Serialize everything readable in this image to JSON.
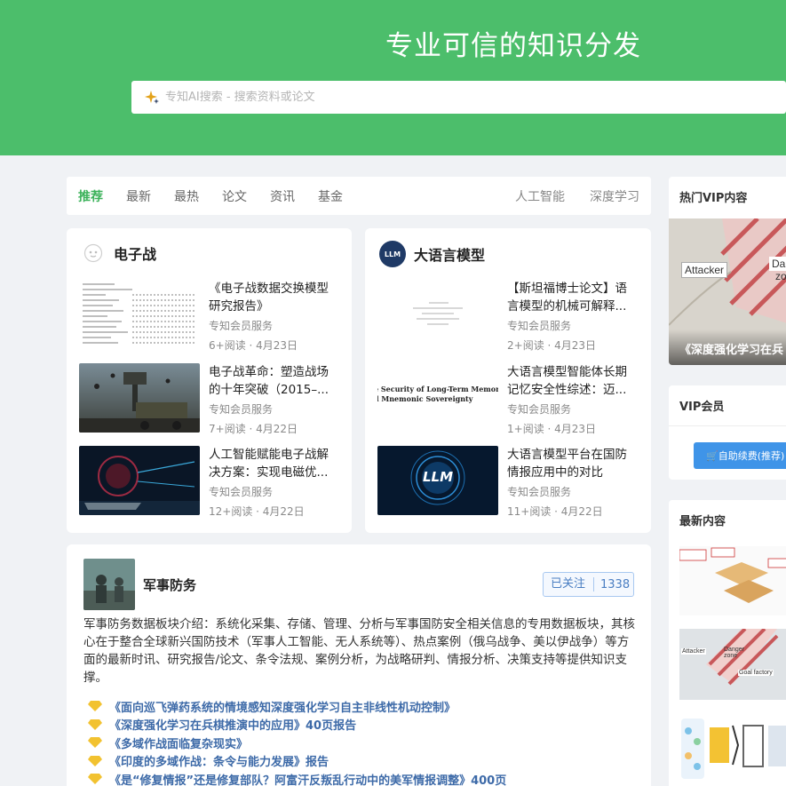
{
  "hero": {
    "title": "专业可信的知识分发",
    "search_placeholder": "专知AI搜索 - 搜索资料或论文",
    "bg_color": "#4cbe6b"
  },
  "tabs": {
    "left": [
      "推荐",
      "最新",
      "最热",
      "论文",
      "资讯",
      "基金"
    ],
    "right": [
      "人工智能",
      "深度学习"
    ],
    "active": "推荐"
  },
  "ew_card": {
    "title": "电子战",
    "items": [
      {
        "title": "《电子战数据交换模型研究报告》",
        "source": "专知会员服务",
        "meta": "6+阅读 · 4月23日"
      },
      {
        "title": "电子战革命：塑造战场的十年突破（2015–...",
        "source": "专知会员服务",
        "meta": "7+阅读 · 4月22日"
      },
      {
        "title": "人工智能赋能电子战解决方案：实现电磁优...",
        "source": "专知会员服务",
        "meta": "12+阅读 · 4月22日"
      }
    ]
  },
  "llm_card": {
    "title": "大语言模型",
    "avatar_text": "LLM",
    "items": [
      {
        "title": "【斯坦福博士论文】语言模型的机械可解释...",
        "source": "专知会员服务",
        "meta": "2+阅读 · 4月23日"
      },
      {
        "title": "大语言模型智能体长期记忆安全性综述：迈...",
        "source": "专知会员服务",
        "meta": "1+阅读 · 4月23日",
        "thumb_text": "e Security of Long-Term Memory\nd Mnemonic Sovereignty"
      },
      {
        "title": "大语言模型平台在国防情报应用中的对比",
        "source": "专知会员服务",
        "meta": "11+阅读 · 4月22日",
        "thumb_text": "LLM"
      }
    ]
  },
  "military": {
    "name": "军事防务",
    "follow_label": "已关注",
    "follow_count": "1338",
    "description": "军事防务数据板块介绍：系统化采集、存储、管理、分析与军事国防安全相关信息的专用数据板块，其核心在于整合全球新兴国防技术（军事人工智能、无人系统等）、热点案例（俄乌战争、美以伊战争）等方面的最新时讯、研究报告/论文、条令法规、案例分析，为战略研判、情报分析、决策支持等提供知识支撑。",
    "links": [
      "《面向巡飞弹药系统的情境感知深度强化学习自主非线性机动控制》",
      "《深度强化学习在兵棋推演中的应用》40页报告",
      "《多域作战面临复杂现实》",
      "《印度的多域作战：条令与能力发展》报告",
      "《是“修复情报”还是修复部队？阿富汗反叛乱行动中的美军情报调整》400页"
    ]
  },
  "sidebar": {
    "hot_vip_title": "热门VIP内容",
    "hot_vip_caption": "《深度强化学习在兵",
    "hot_vip_img_labels": [
      "Attacker",
      "Da",
      "zo"
    ],
    "vip_title": "VIP会员",
    "vip_button": "🛒自助续费(推荐)",
    "latest_title": "最新内容",
    "latest_img_labels": [
      "Attacker",
      "Danger zone",
      "Goal factory"
    ]
  }
}
